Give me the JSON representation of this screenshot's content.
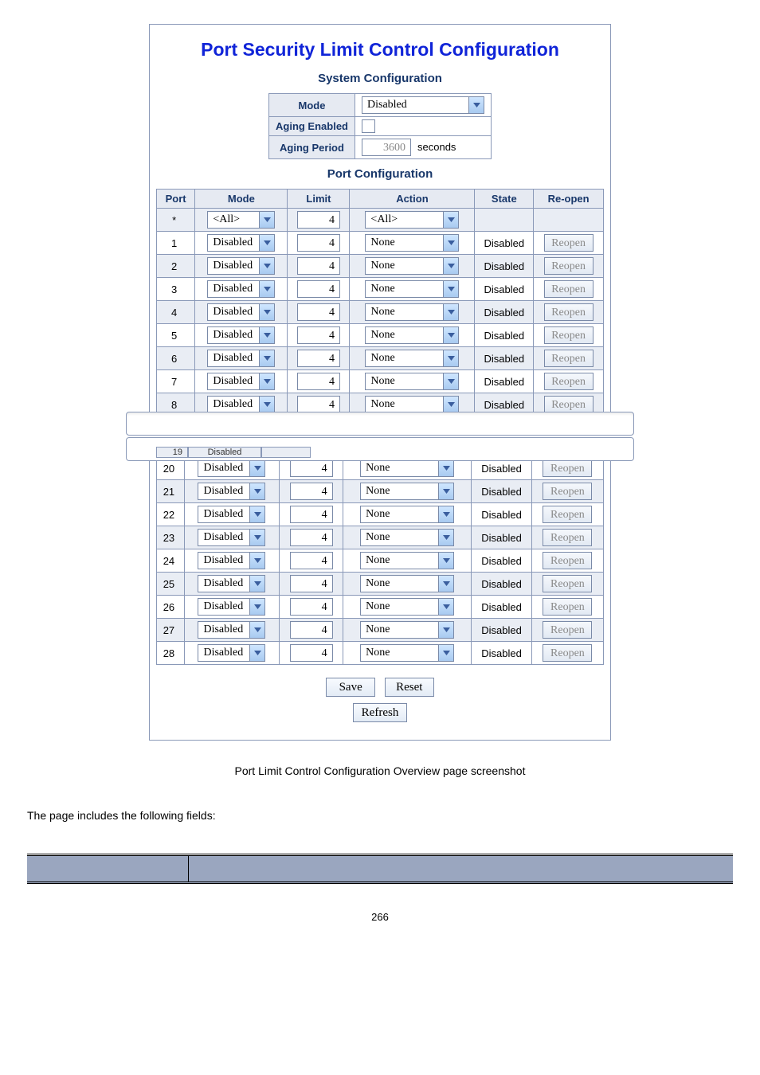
{
  "title": "Port Security Limit Control Configuration",
  "system_heading": "System Configuration",
  "port_heading": "Port Configuration",
  "sys": {
    "mode_label": "Mode",
    "mode_value": "Disabled",
    "aging_enabled_label": "Aging Enabled",
    "aging_period_label": "Aging Period",
    "aging_period_value": "3600",
    "seconds_label": "seconds"
  },
  "headers": {
    "port": "Port",
    "mode": "Mode",
    "limit": "Limit",
    "action": "Action",
    "state": "State",
    "reopen": "Re-open"
  },
  "top_rows": [
    {
      "port": "*",
      "mode": "<All>",
      "limit": "4",
      "action": "<All>",
      "state": "",
      "reopen": ""
    },
    {
      "port": "1",
      "mode": "Disabled",
      "limit": "4",
      "action": "None",
      "state": "Disabled",
      "reopen": "Reopen"
    },
    {
      "port": "2",
      "mode": "Disabled",
      "limit": "4",
      "action": "None",
      "state": "Disabled",
      "reopen": "Reopen"
    },
    {
      "port": "3",
      "mode": "Disabled",
      "limit": "4",
      "action": "None",
      "state": "Disabled",
      "reopen": "Reopen"
    },
    {
      "port": "4",
      "mode": "Disabled",
      "limit": "4",
      "action": "None",
      "state": "Disabled",
      "reopen": "Reopen"
    },
    {
      "port": "5",
      "mode": "Disabled",
      "limit": "4",
      "action": "None",
      "state": "Disabled",
      "reopen": "Reopen"
    },
    {
      "port": "6",
      "mode": "Disabled",
      "limit": "4",
      "action": "None",
      "state": "Disabled",
      "reopen": "Reopen"
    },
    {
      "port": "7",
      "mode": "Disabled",
      "limit": "4",
      "action": "None",
      "state": "Disabled",
      "reopen": "Reopen"
    },
    {
      "port": "8",
      "mode": "Disabled",
      "limit": "4",
      "action": "None",
      "state": "Disabled",
      "reopen": "Reopen"
    }
  ],
  "cut_fragment": {
    "port": "19",
    "mode": "Disabled"
  },
  "bottom_rows": [
    {
      "port": "20",
      "mode": "Disabled",
      "limit": "4",
      "action": "None",
      "state": "Disabled",
      "reopen": "Reopen"
    },
    {
      "port": "21",
      "mode": "Disabled",
      "limit": "4",
      "action": "None",
      "state": "Disabled",
      "reopen": "Reopen"
    },
    {
      "port": "22",
      "mode": "Disabled",
      "limit": "4",
      "action": "None",
      "state": "Disabled",
      "reopen": "Reopen"
    },
    {
      "port": "23",
      "mode": "Disabled",
      "limit": "4",
      "action": "None",
      "state": "Disabled",
      "reopen": "Reopen"
    },
    {
      "port": "24",
      "mode": "Disabled",
      "limit": "4",
      "action": "None",
      "state": "Disabled",
      "reopen": "Reopen"
    },
    {
      "port": "25",
      "mode": "Disabled",
      "limit": "4",
      "action": "None",
      "state": "Disabled",
      "reopen": "Reopen"
    },
    {
      "port": "26",
      "mode": "Disabled",
      "limit": "4",
      "action": "None",
      "state": "Disabled",
      "reopen": "Reopen"
    },
    {
      "port": "27",
      "mode": "Disabled",
      "limit": "4",
      "action": "None",
      "state": "Disabled",
      "reopen": "Reopen"
    },
    {
      "port": "28",
      "mode": "Disabled",
      "limit": "4",
      "action": "None",
      "state": "Disabled",
      "reopen": "Reopen"
    }
  ],
  "buttons": {
    "save": "Save",
    "reset": "Reset",
    "refresh": "Refresh"
  },
  "caption": "Port Limit Control Configuration Overview page screenshot",
  "intro": "The page includes the following fields:",
  "page_number": "266"
}
